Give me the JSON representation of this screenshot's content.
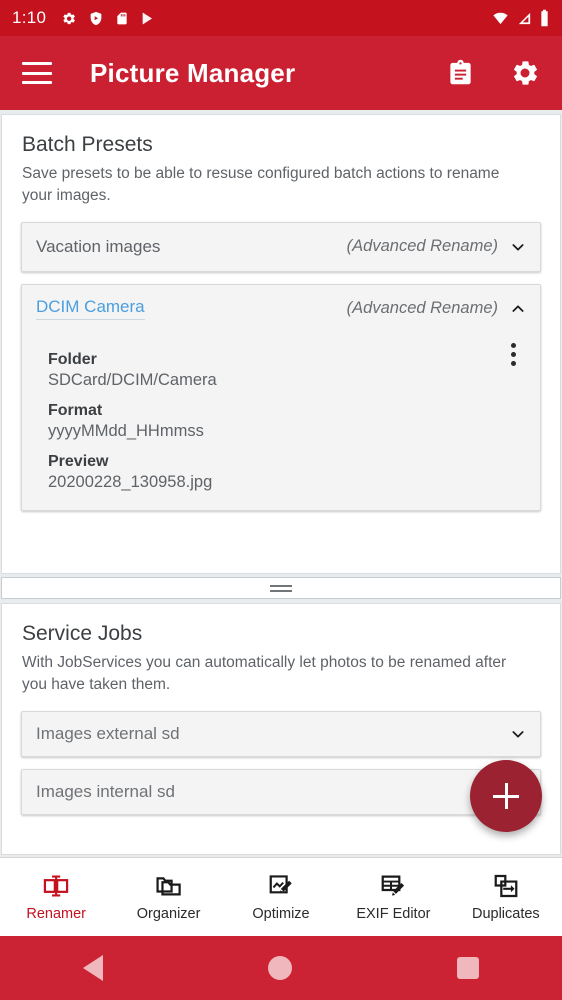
{
  "status_bar": {
    "time": "1:10",
    "left_icons": [
      "gear-icon",
      "shield-play-icon",
      "sdcard-icon",
      "play-store-icon"
    ],
    "right_icons": [
      "wifi-icon",
      "signal-icon",
      "battery-icon"
    ],
    "background_color": "#c4121f"
  },
  "app_bar": {
    "title": "Picture Manager",
    "menu_icon": "hamburger-icon",
    "actions": [
      "clipboard-icon",
      "gear-icon"
    ],
    "background_color": "#cb2032"
  },
  "batch_presets": {
    "title": "Batch Presets",
    "description": "Save presets to be able to resuse configured batch actions to rename your images.",
    "presets": [
      {
        "name": "Vacation images",
        "type": "(Advanced Rename)",
        "expanded": false,
        "chevron": "chevron-down-icon"
      },
      {
        "name": "DCIM Camera",
        "type": "(Advanced Rename)",
        "expanded": true,
        "chevron": "chevron-up-icon",
        "details": [
          {
            "label": "Folder",
            "value": "SDCard/DCIM/Camera"
          },
          {
            "label": "Format",
            "value": "yyyyMMdd_HHmmss"
          },
          {
            "label": "Preview",
            "value": "20200228_130958.jpg"
          }
        ]
      }
    ]
  },
  "drag_handle": {
    "icon": "drag-handle-icon"
  },
  "service_jobs": {
    "title": "Service Jobs",
    "description": "With JobServices you can automatically let photos to be renamed after you have taken them.",
    "jobs": [
      {
        "name": "Images external sd",
        "chevron": "chevron-down-icon"
      },
      {
        "name": "Images internal sd",
        "chevron": ""
      }
    ]
  },
  "fab": {
    "icon": "plus-icon",
    "color": "#9b2230"
  },
  "bottom_nav": {
    "active_color": "#c4121f",
    "items": [
      {
        "label": "Renamer",
        "icon": "rename-cursor-icon",
        "active": true
      },
      {
        "label": "Organizer",
        "icon": "folder-copy-icon",
        "active": false
      },
      {
        "label": "Optimize",
        "icon": "image-edit-icon",
        "active": false
      },
      {
        "label": "EXIF Editor",
        "icon": "table-edit-icon",
        "active": false
      },
      {
        "label": "Duplicates",
        "icon": "duplicate-icon",
        "active": false
      }
    ]
  },
  "android_nav": {
    "back": "back-triangle-icon",
    "home": "home-circle-icon",
    "recents": "recents-square-icon"
  }
}
